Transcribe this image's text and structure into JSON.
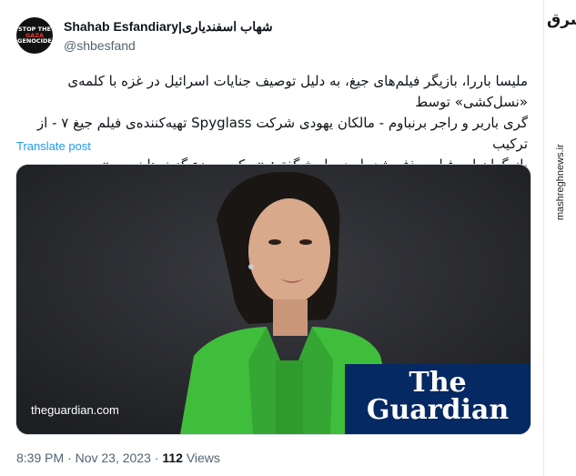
{
  "author": {
    "display_name": "Shahab Esfandiary|شهاب اسفندیاری",
    "handle": "@shbesfand",
    "avatar_text": [
      "STOP THE",
      "GAZA",
      "GENOCIDE"
    ]
  },
  "tweet": {
    "lines": [
      "ملیسا باررا، بازیگر فیلم‌های جیغ، به دلیل توصیف جنایات اسرائیل در غزه با کلمه‌ی «نسل‌کشی» توسط",
      "گری باربر و راجر برنباوم - مالکان یهودی شرکت Spyglass تهیه‌کننده‌ی فیلم جیغ ۷ - از ترکیب",
      "بازیگران این فیلم حذف شد. او در پاسخ گفته: «سکوت جزء گزینه‌ها نیست»."
    ],
    "translate_label": "Translate post"
  },
  "media": {
    "source": "theguardian.com",
    "logo_line1": "The",
    "logo_line2": "Guardian"
  },
  "meta": {
    "time": "8:39 PM",
    "date": "Nov 23, 2023",
    "views_count": "112",
    "views_label": "Views",
    "separator": "·"
  },
  "watermark": {
    "logo_text": "مشرق",
    "url": "mashreghnews.ir"
  },
  "colors": {
    "link": "#1d9bf0",
    "guardian_blue": "#052962",
    "blazer_green": "#3fbe3c"
  }
}
